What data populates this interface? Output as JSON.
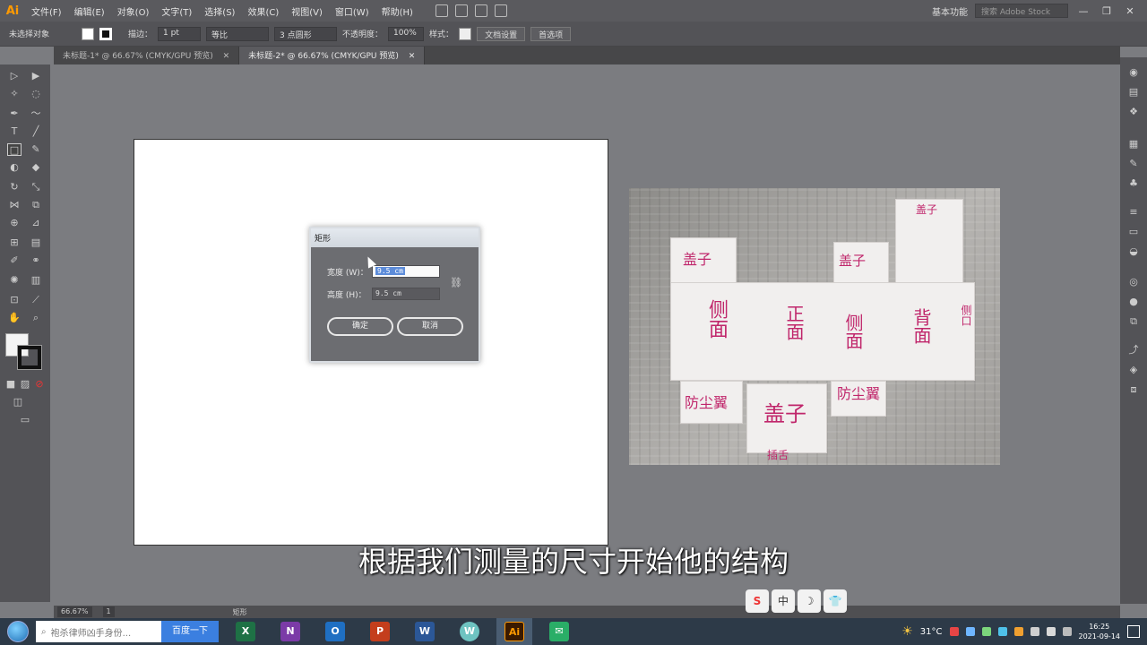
{
  "menubar": {
    "logo": "Ai",
    "items": [
      "文件(F)",
      "编辑(E)",
      "对象(O)",
      "文字(T)",
      "选择(S)",
      "效果(C)",
      "视图(V)",
      "窗口(W)",
      "帮助(H)"
    ],
    "workspace": "基本功能",
    "stock_search_placeholder": "搜索 Adobe Stock",
    "window_controls": [
      "—",
      "❐",
      "✕"
    ]
  },
  "controlbar": {
    "selection_label": "未选择对象",
    "stroke_label": "描边：",
    "stroke_value": "1 pt",
    "stroke_profile": "等比",
    "brush": "3 点圆形",
    "opacity_label": "不透明度：",
    "opacity_value": "100%",
    "style_label": "样式：",
    "doc_setup_button": "文档设置",
    "prefs_button": "首选项"
  },
  "tabs": [
    {
      "label": "未标题-1* @ 66.67% (CMYK/GPU 预览)",
      "close": "✕",
      "active": false
    },
    {
      "label": "未标题-2* @ 66.67% (CMYK/GPU 预览)",
      "close": "✕",
      "active": true
    }
  ],
  "dialog": {
    "title": "矩形",
    "width_label": "宽度 (W)：",
    "width_value": "9.5 cm",
    "height_label": "高度 (H)：",
    "height_value": "9.5 cm",
    "ok_button": "确定",
    "cancel_button": "取消",
    "link_icon": "chain-link-icon"
  },
  "photo_labels": {
    "top_flap": "盖子",
    "left_flap": "盖子",
    "mid_flap": "盖子",
    "side_left": "侧面",
    "front": "正面",
    "side_mid": "侧面",
    "back": "背面",
    "bottom_left": "防尘翼",
    "bottom_center": "盖子",
    "bottom_right": "防尘翼",
    "bottom_edge": "插舌",
    "right_edge": "侧口"
  },
  "subtitle": "根据我们测量的尺寸开始他的结构",
  "statusbar": {
    "zoom": "66.67%",
    "page": "1",
    "tool": "矩形"
  },
  "ime": [
    "S",
    "中",
    "☽",
    "👕"
  ],
  "taskbar": {
    "search_placeholder": "袍杀律师凶手身份...",
    "search_button": "百度一下",
    "apps": [
      {
        "letter": "X",
        "color": "#1e7145"
      },
      {
        "letter": "N",
        "color": "#7b3ba7"
      },
      {
        "letter": "O",
        "color": "#1f6fc2"
      },
      {
        "letter": "P",
        "color": "#c43e1c"
      },
      {
        "letter": "W",
        "color": "#2b5797"
      },
      {
        "letter": "W",
        "color": "#6ec3c1"
      },
      {
        "letter": "Ai",
        "color": "#3a1a00"
      },
      {
        "letter": "✉",
        "color": "#2aae67"
      }
    ],
    "temperature": "31°C",
    "time": "16:25",
    "date": "2021-09-14"
  }
}
